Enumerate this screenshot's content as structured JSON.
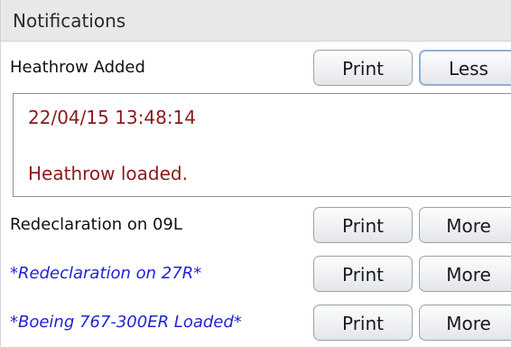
{
  "panel": {
    "title": "Notifications"
  },
  "expanded_notification": {
    "label": "Heathrow Added",
    "print_label": "Print",
    "toggle_label": "Less",
    "timestamp": "22/04/15 13:48:14",
    "message": "Heathrow loaded."
  },
  "notifications": [
    {
      "label": "Redeclaration on 09L",
      "print_label": "Print",
      "toggle_label": "More",
      "style": "normal"
    },
    {
      "label": "*Redeclaration on 27R*",
      "print_label": "Print",
      "toggle_label": "More",
      "style": "unread"
    },
    {
      "label": "*Boeing 767-300ER Loaded*",
      "print_label": "Print",
      "toggle_label": "More",
      "style": "unread"
    }
  ],
  "colors": {
    "unread_text": "#2323d6",
    "message_text": "#8b1a1a",
    "header_background": "#e8e8e8",
    "active_button_border": "#8fb2d6"
  }
}
